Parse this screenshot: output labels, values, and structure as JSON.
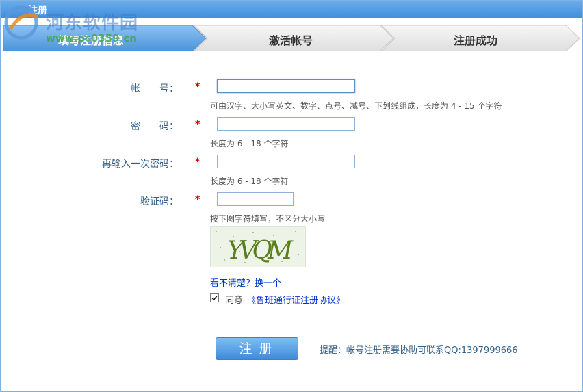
{
  "window": {
    "title": "注册"
  },
  "watermark": {
    "site": "河东软件园",
    "url": "www.pc0359.cn"
  },
  "steps": [
    {
      "label": "填写注册信息",
      "active": true
    },
    {
      "label": "激活帐号",
      "active": false
    },
    {
      "label": "注册成功",
      "active": false
    }
  ],
  "form": {
    "required_mark": "*",
    "account": {
      "label": "帐　　号：",
      "value": "",
      "hint": "可由汉字、大小写英文、数字、点号、减号、下划线组成，长度为 4 - 15 个字符"
    },
    "password": {
      "label": "密　　码：",
      "value": "",
      "hint": "长度为 6 - 18 个字符"
    },
    "password_confirm": {
      "label": "再输入一次密码：",
      "value": "",
      "hint": "长度为 6 - 18 个字符"
    },
    "captcha": {
      "label": "验证码：",
      "value": "",
      "hint": "按下图字符填写，不区分大小写",
      "image_text": "YVQM"
    },
    "refresh_link": "看不清楚？换一个",
    "agree": {
      "checked": true,
      "label": "同意",
      "link": "《鲁班通行证注册协议》"
    }
  },
  "submit_button": {
    "label": "注册"
  },
  "reminder": "提醒：帐号注册需要协助可联系QQ:1397999666",
  "colors": {
    "titlebar": "#3f8ddc",
    "active_step": "#5a9ee0",
    "required": "#d10000",
    "link": "#0033cc"
  }
}
